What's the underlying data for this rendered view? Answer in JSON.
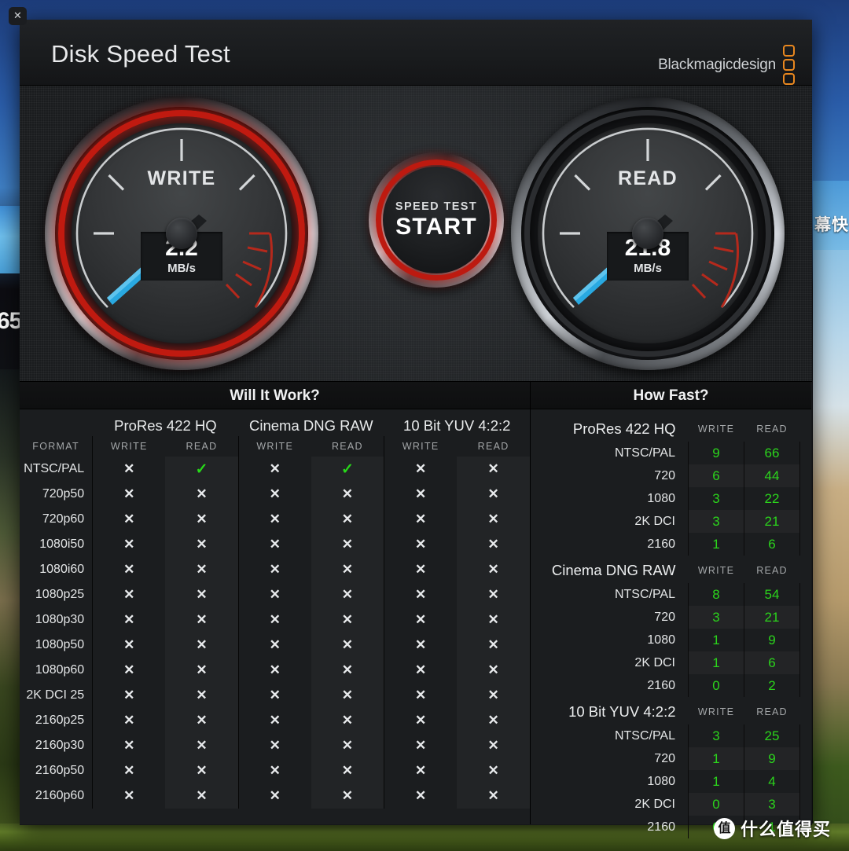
{
  "window": {
    "title": "Disk Speed Test",
    "brand": "Blackmagicdesign",
    "close_label": "✕"
  },
  "gauges": {
    "write": {
      "label": "WRITE",
      "value": "2.2",
      "unit": "MB/s",
      "numeric": 2.2,
      "active": true
    },
    "read": {
      "label": "READ",
      "value": "21.8",
      "unit": "MB/s",
      "numeric": 21.8,
      "active": false
    }
  },
  "start_button": {
    "sub_label": "SPEED TEST",
    "main_label": "START"
  },
  "settings_button": {
    "icon": "gear-icon"
  },
  "will_it_work": {
    "title": "Will It Work?",
    "format_header": "FORMAT",
    "codecs": [
      "ProRes 422 HQ",
      "Cinema DNG RAW",
      "10 Bit YUV 4:2:2"
    ],
    "sub_headers": [
      "WRITE",
      "READ"
    ],
    "ok_glyph": "✓",
    "no_glyph": "✕",
    "rows": [
      {
        "format": "NTSC/PAL",
        "cells": [
          false,
          true,
          false,
          true,
          false,
          false
        ]
      },
      {
        "format": "720p50",
        "cells": [
          false,
          false,
          false,
          false,
          false,
          false
        ]
      },
      {
        "format": "720p60",
        "cells": [
          false,
          false,
          false,
          false,
          false,
          false
        ]
      },
      {
        "format": "1080i50",
        "cells": [
          false,
          false,
          false,
          false,
          false,
          false
        ]
      },
      {
        "format": "1080i60",
        "cells": [
          false,
          false,
          false,
          false,
          false,
          false
        ]
      },
      {
        "format": "1080p25",
        "cells": [
          false,
          false,
          false,
          false,
          false,
          false
        ]
      },
      {
        "format": "1080p30",
        "cells": [
          false,
          false,
          false,
          false,
          false,
          false
        ]
      },
      {
        "format": "1080p50",
        "cells": [
          false,
          false,
          false,
          false,
          false,
          false
        ]
      },
      {
        "format": "1080p60",
        "cells": [
          false,
          false,
          false,
          false,
          false,
          false
        ]
      },
      {
        "format": "2K DCI 25",
        "cells": [
          false,
          false,
          false,
          false,
          false,
          false
        ]
      },
      {
        "format": "2160p25",
        "cells": [
          false,
          false,
          false,
          false,
          false,
          false
        ]
      },
      {
        "format": "2160p30",
        "cells": [
          false,
          false,
          false,
          false,
          false,
          false
        ]
      },
      {
        "format": "2160p50",
        "cells": [
          false,
          false,
          false,
          false,
          false,
          false
        ]
      },
      {
        "format": "2160p60",
        "cells": [
          false,
          false,
          false,
          false,
          false,
          false
        ]
      }
    ]
  },
  "how_fast": {
    "title": "How Fast?",
    "sub_headers": [
      "WRITE",
      "READ"
    ],
    "groups": [
      {
        "codec": "ProRes 422 HQ",
        "rows": [
          {
            "res": "NTSC/PAL",
            "write": "9",
            "read": "66"
          },
          {
            "res": "720",
            "write": "6",
            "read": "44"
          },
          {
            "res": "1080",
            "write": "3",
            "read": "22"
          },
          {
            "res": "2K DCI",
            "write": "3",
            "read": "21"
          },
          {
            "res": "2160",
            "write": "1",
            "read": "6"
          }
        ]
      },
      {
        "codec": "Cinema DNG RAW",
        "rows": [
          {
            "res": "NTSC/PAL",
            "write": "8",
            "read": "54"
          },
          {
            "res": "720",
            "write": "3",
            "read": "21"
          },
          {
            "res": "1080",
            "write": "1",
            "read": "9"
          },
          {
            "res": "2K DCI",
            "write": "1",
            "read": "6"
          },
          {
            "res": "2160",
            "write": "0",
            "read": "2"
          }
        ]
      },
      {
        "codec": "10 Bit YUV 4:2:2",
        "rows": [
          {
            "res": "NTSC/PAL",
            "write": "3",
            "read": "25"
          },
          {
            "res": "720",
            "write": "1",
            "read": "9"
          },
          {
            "res": "1080",
            "write": "1",
            "read": "4"
          },
          {
            "res": "2K DCI",
            "write": "0",
            "read": "3"
          },
          {
            "res": "2160",
            "write": "0",
            "read": "1"
          }
        ]
      }
    ]
  },
  "watermark": {
    "logo_char": "值",
    "text": "什么值得买"
  },
  "desktop": {
    "left_fragment": "65",
    "right_fragment": "幕快"
  },
  "colors": {
    "accent_red": "#c01a10",
    "brand_orange": "#e8871f",
    "needle_blue": "#29a9e1",
    "ok_green": "#27d819",
    "value_green": "#2bd41c",
    "panel_bg": "#1b1d1f"
  }
}
